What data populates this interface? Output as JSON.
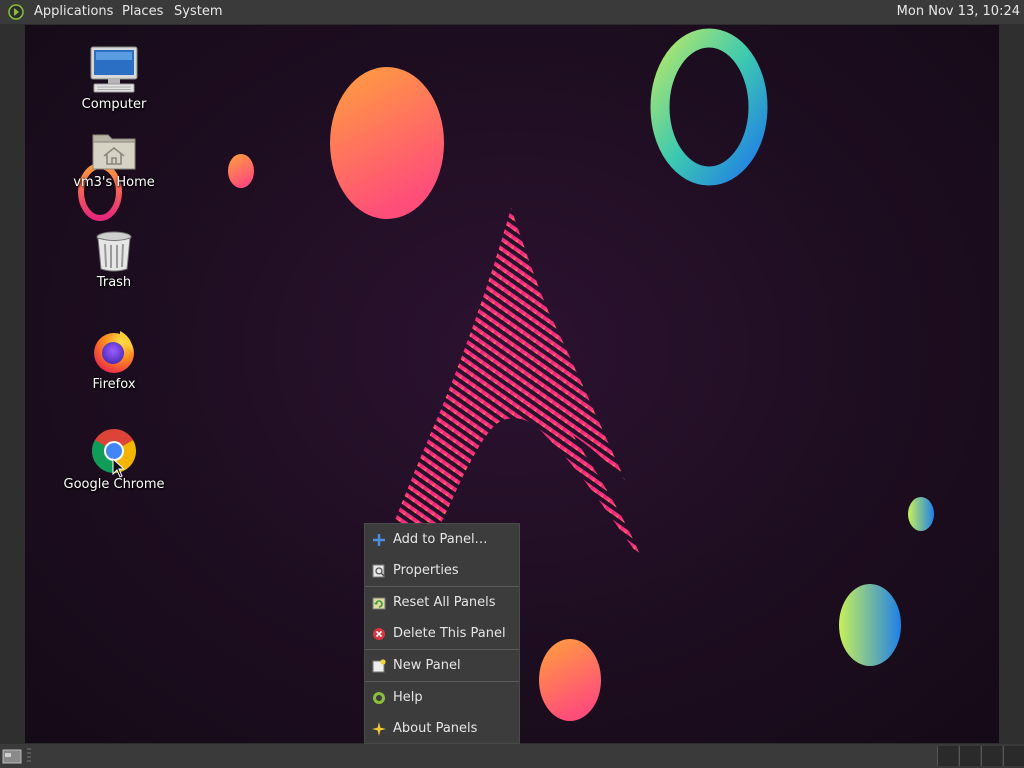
{
  "top_panel": {
    "menus": [
      "Applications",
      "Places",
      "System"
    ],
    "clock": "Mon Nov 13, 10:24"
  },
  "desktop_icons": [
    {
      "label": "Computer",
      "icon": "computer-icon"
    },
    {
      "label": "vm3's Home",
      "icon": "home-folder-icon"
    },
    {
      "label": "Trash",
      "icon": "trash-icon"
    },
    {
      "label": "Firefox",
      "icon": "firefox-icon"
    },
    {
      "label": "Google Chrome",
      "icon": "chrome-icon"
    }
  ],
  "context_menu": {
    "items": [
      {
        "label": "Add to Panel…",
        "icon": "plus-icon"
      },
      {
        "label": "Properties",
        "icon": "properties-icon"
      },
      {
        "label": "Reset All Panels",
        "icon": "reset-icon"
      },
      {
        "label": "Delete This Panel",
        "icon": "delete-icon"
      },
      {
        "label": "New Panel",
        "icon": "new-panel-icon"
      },
      {
        "label": "Help",
        "icon": "help-icon"
      },
      {
        "label": "About Panels",
        "icon": "about-icon"
      }
    ]
  },
  "colors": {
    "panel": "#3a3a3a",
    "menu_bg": "#3c3c3c",
    "desktop_bg": "#1d0d20",
    "accent_pink": "#e8267a",
    "accent_orange": "#ff9a3c",
    "accent_blue": "#1f8fe8"
  }
}
